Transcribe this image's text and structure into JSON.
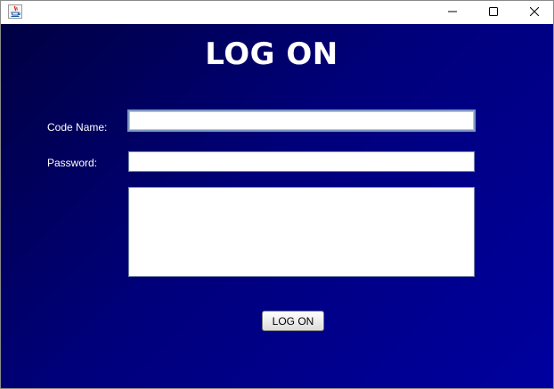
{
  "window": {
    "icon": "java-icon",
    "controls": {
      "minimize_icon": "minimize-icon",
      "maximize_icon": "maximize-icon",
      "close_icon": "close-icon"
    }
  },
  "form": {
    "title": "LOG ON",
    "code_name_label": "Code Name:",
    "code_name_value": "",
    "password_label": "Password:",
    "password_value": "",
    "message_text": "",
    "submit_label": "LOG ON"
  },
  "colors": {
    "background_start": "#000042",
    "background_end": "#00009f",
    "title_text": "#ffffff",
    "label_text": "#ffffff"
  }
}
